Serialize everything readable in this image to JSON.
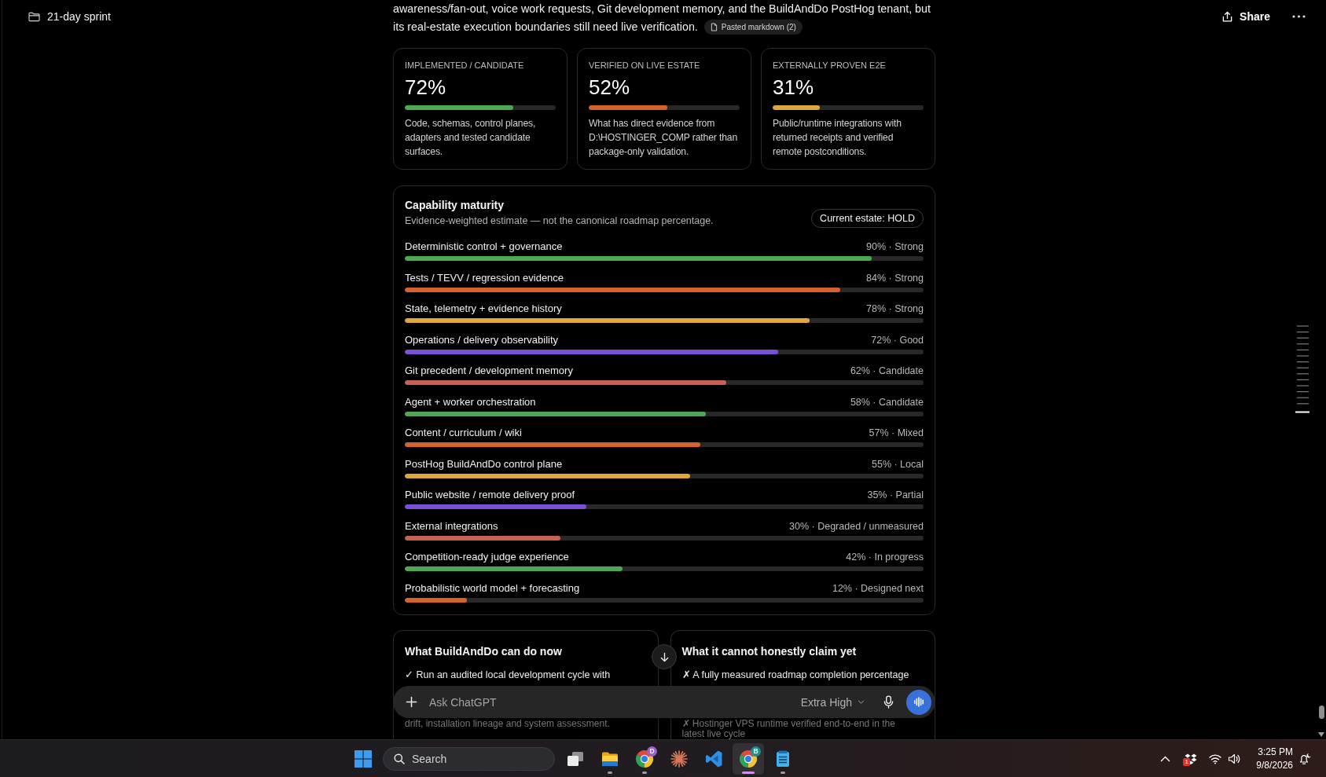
{
  "project": {
    "title": "21-day sprint"
  },
  "header_actions": {
    "share": "Share"
  },
  "message": {
    "text_lines": [
      "awareness/fan-out, voice work requests, Git development memory, and the BuildAndDo PostHog tenant, but",
      "its real-estate execution boundaries still need live verification."
    ],
    "attachment": "Pasted markdown (2)"
  },
  "summary_cards": [
    {
      "label": "IMPLEMENTED / CANDIDATE",
      "value": "72%",
      "level": 0.72,
      "color": "#4ea852",
      "description": "Code, schemas, control planes, adapters and tested candidate surfaces."
    },
    {
      "label": "VERIFIED ON LIVE ESTATE",
      "value": "52%",
      "level": 0.52,
      "color": "#d5622a",
      "description": "What has direct evidence from D:\\HOSTINGER_COMP rather than package-only validation."
    },
    {
      "label": "EXTERNALLY PROVEN E2E",
      "value": "31%",
      "level": 0.31,
      "color": "#dfa73b",
      "description": "Public/runtime integrations with returned receipts and verified remote postconditions."
    }
  ],
  "capability_maturity": {
    "title": "Capability maturity",
    "subtitle": "Evidence-weighted estimate — not the canonical roadmap percentage.",
    "estate_badge": "Current estate: HOLD",
    "rows": [
      {
        "name": "Deterministic control + governance",
        "reading": "90% · Strong",
        "level": 0.9,
        "color": "#4ea852"
      },
      {
        "name": "Tests / TEVV / regression evidence",
        "reading": "84% · Strong",
        "level": 0.84,
        "color": "#d5622a"
      },
      {
        "name": "State, telemetry + evidence history",
        "reading": "78% · Strong",
        "level": 0.78,
        "color": "#dfa73b"
      },
      {
        "name": "Operations / delivery observability",
        "reading": "72% · Good",
        "level": 0.72,
        "color": "#7c4fd9"
      },
      {
        "name": "Git precedent / development memory",
        "reading": "62% · Candidate",
        "level": 0.62,
        "color": "#c96152"
      },
      {
        "name": "Agent + worker orchestration",
        "reading": "58% · Candidate",
        "level": 0.58,
        "color": "#4ea852"
      },
      {
        "name": "Content / curriculum / wiki",
        "reading": "57% · Mixed",
        "level": 0.57,
        "color": "#d5622a"
      },
      {
        "name": "PostHog BuildAndDo control plane",
        "reading": "55% · Local",
        "level": 0.55,
        "color": "#dfa73b"
      },
      {
        "name": "Public website / remote delivery proof",
        "reading": "35% · Partial",
        "level": 0.35,
        "color": "#7c4fd9"
      },
      {
        "name": "External integrations",
        "reading": "30% · Degraded / unmeasured",
        "level": 0.3,
        "color": "#c96152"
      },
      {
        "name": "Competition-ready judge experience",
        "reading": "42% · In progress",
        "level": 0.42,
        "color": "#4ea852"
      },
      {
        "name": "Probabilistic world model + forecasting",
        "reading": "12% · Designed next",
        "level": 0.12,
        "color": "#d5622a"
      }
    ]
  },
  "claims": [
    {
      "title": "What BuildAndDo can do now",
      "visible_lines": [
        "✓ Run an audited local development cycle with"
      ],
      "faded_lines": [
        "drift, installation lineage and system assessment."
      ]
    },
    {
      "title": "What it cannot honestly claim yet",
      "visible_lines": [
        "✗ A fully measured roadmap completion percentage"
      ],
      "faded_lines": [
        "✗ Hostinger VPS runtime verified end-to-end in the",
        "latest live cycle"
      ]
    }
  ],
  "composer": {
    "placeholder": "Ask ChatGPT",
    "effort": "Extra High"
  },
  "taskbar": {
    "search": {
      "placeholder": "Search"
    },
    "apps": [
      {
        "kind": "taskview",
        "running": false,
        "selected": false
      },
      {
        "kind": "explorer",
        "running": true,
        "selected": false
      },
      {
        "kind": "browser",
        "badge": {
          "text": "D",
          "color": "#9a5fd3"
        },
        "running": true,
        "selected": false
      },
      {
        "kind": "starburst",
        "running": false,
        "selected": false
      },
      {
        "kind": "editor",
        "running": false,
        "selected": false
      },
      {
        "kind": "browser",
        "badge": {
          "text": "B",
          "color": "#1e8f8a"
        },
        "running": true,
        "selected": true
      },
      {
        "kind": "notepad",
        "running": true,
        "selected": false
      }
    ],
    "tray": {
      "badge": "1",
      "time": "3:25 PM",
      "date": "9/8/2026"
    }
  }
}
